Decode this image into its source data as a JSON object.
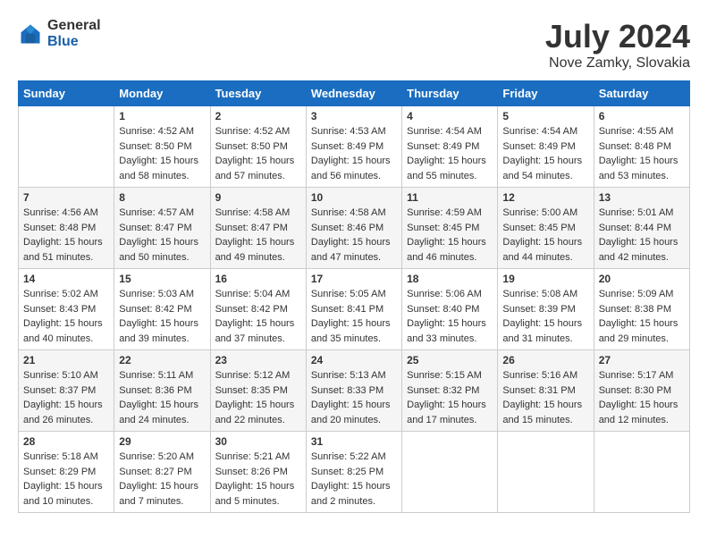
{
  "header": {
    "logo_general": "General",
    "logo_blue": "Blue",
    "month_year": "July 2024",
    "location": "Nove Zamky, Slovakia"
  },
  "days_of_week": [
    "Sunday",
    "Monday",
    "Tuesday",
    "Wednesday",
    "Thursday",
    "Friday",
    "Saturday"
  ],
  "weeks": [
    [
      {
        "day": "",
        "info": ""
      },
      {
        "day": "1",
        "info": "Sunrise: 4:52 AM\nSunset: 8:50 PM\nDaylight: 15 hours\nand 58 minutes."
      },
      {
        "day": "2",
        "info": "Sunrise: 4:52 AM\nSunset: 8:50 PM\nDaylight: 15 hours\nand 57 minutes."
      },
      {
        "day": "3",
        "info": "Sunrise: 4:53 AM\nSunset: 8:49 PM\nDaylight: 15 hours\nand 56 minutes."
      },
      {
        "day": "4",
        "info": "Sunrise: 4:54 AM\nSunset: 8:49 PM\nDaylight: 15 hours\nand 55 minutes."
      },
      {
        "day": "5",
        "info": "Sunrise: 4:54 AM\nSunset: 8:49 PM\nDaylight: 15 hours\nand 54 minutes."
      },
      {
        "day": "6",
        "info": "Sunrise: 4:55 AM\nSunset: 8:48 PM\nDaylight: 15 hours\nand 53 minutes."
      }
    ],
    [
      {
        "day": "7",
        "info": "Sunrise: 4:56 AM\nSunset: 8:48 PM\nDaylight: 15 hours\nand 51 minutes."
      },
      {
        "day": "8",
        "info": "Sunrise: 4:57 AM\nSunset: 8:47 PM\nDaylight: 15 hours\nand 50 minutes."
      },
      {
        "day": "9",
        "info": "Sunrise: 4:58 AM\nSunset: 8:47 PM\nDaylight: 15 hours\nand 49 minutes."
      },
      {
        "day": "10",
        "info": "Sunrise: 4:58 AM\nSunset: 8:46 PM\nDaylight: 15 hours\nand 47 minutes."
      },
      {
        "day": "11",
        "info": "Sunrise: 4:59 AM\nSunset: 8:45 PM\nDaylight: 15 hours\nand 46 minutes."
      },
      {
        "day": "12",
        "info": "Sunrise: 5:00 AM\nSunset: 8:45 PM\nDaylight: 15 hours\nand 44 minutes."
      },
      {
        "day": "13",
        "info": "Sunrise: 5:01 AM\nSunset: 8:44 PM\nDaylight: 15 hours\nand 42 minutes."
      }
    ],
    [
      {
        "day": "14",
        "info": "Sunrise: 5:02 AM\nSunset: 8:43 PM\nDaylight: 15 hours\nand 40 minutes."
      },
      {
        "day": "15",
        "info": "Sunrise: 5:03 AM\nSunset: 8:42 PM\nDaylight: 15 hours\nand 39 minutes."
      },
      {
        "day": "16",
        "info": "Sunrise: 5:04 AM\nSunset: 8:42 PM\nDaylight: 15 hours\nand 37 minutes."
      },
      {
        "day": "17",
        "info": "Sunrise: 5:05 AM\nSunset: 8:41 PM\nDaylight: 15 hours\nand 35 minutes."
      },
      {
        "day": "18",
        "info": "Sunrise: 5:06 AM\nSunset: 8:40 PM\nDaylight: 15 hours\nand 33 minutes."
      },
      {
        "day": "19",
        "info": "Sunrise: 5:08 AM\nSunset: 8:39 PM\nDaylight: 15 hours\nand 31 minutes."
      },
      {
        "day": "20",
        "info": "Sunrise: 5:09 AM\nSunset: 8:38 PM\nDaylight: 15 hours\nand 29 minutes."
      }
    ],
    [
      {
        "day": "21",
        "info": "Sunrise: 5:10 AM\nSunset: 8:37 PM\nDaylight: 15 hours\nand 26 minutes."
      },
      {
        "day": "22",
        "info": "Sunrise: 5:11 AM\nSunset: 8:36 PM\nDaylight: 15 hours\nand 24 minutes."
      },
      {
        "day": "23",
        "info": "Sunrise: 5:12 AM\nSunset: 8:35 PM\nDaylight: 15 hours\nand 22 minutes."
      },
      {
        "day": "24",
        "info": "Sunrise: 5:13 AM\nSunset: 8:33 PM\nDaylight: 15 hours\nand 20 minutes."
      },
      {
        "day": "25",
        "info": "Sunrise: 5:15 AM\nSunset: 8:32 PM\nDaylight: 15 hours\nand 17 minutes."
      },
      {
        "day": "26",
        "info": "Sunrise: 5:16 AM\nSunset: 8:31 PM\nDaylight: 15 hours\nand 15 minutes."
      },
      {
        "day": "27",
        "info": "Sunrise: 5:17 AM\nSunset: 8:30 PM\nDaylight: 15 hours\nand 12 minutes."
      }
    ],
    [
      {
        "day": "28",
        "info": "Sunrise: 5:18 AM\nSunset: 8:29 PM\nDaylight: 15 hours\nand 10 minutes."
      },
      {
        "day": "29",
        "info": "Sunrise: 5:20 AM\nSunset: 8:27 PM\nDaylight: 15 hours\nand 7 minutes."
      },
      {
        "day": "30",
        "info": "Sunrise: 5:21 AM\nSunset: 8:26 PM\nDaylight: 15 hours\nand 5 minutes."
      },
      {
        "day": "31",
        "info": "Sunrise: 5:22 AM\nSunset: 8:25 PM\nDaylight: 15 hours\nand 2 minutes."
      },
      {
        "day": "",
        "info": ""
      },
      {
        "day": "",
        "info": ""
      },
      {
        "day": "",
        "info": ""
      }
    ]
  ]
}
